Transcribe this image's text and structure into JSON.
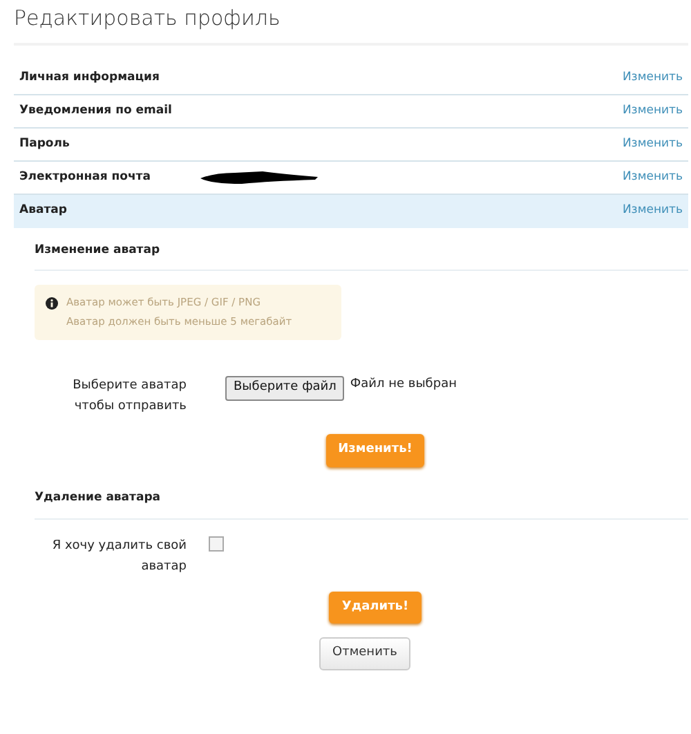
{
  "title": "Редактировать профиль",
  "sections": [
    {
      "label": "Личная информация",
      "action": "Изменить",
      "selected": false,
      "redacted": false
    },
    {
      "label": "Уведомления по email",
      "action": "Изменить",
      "selected": false,
      "redacted": false
    },
    {
      "label": "Пароль",
      "action": "Изменить",
      "selected": false,
      "redacted": false
    },
    {
      "label": "Электронная почта",
      "action": "Изменить",
      "selected": false,
      "redacted": true
    },
    {
      "label": "Аватар",
      "action": "Изменить",
      "selected": true,
      "redacted": false
    }
  ],
  "change_avatar": {
    "heading": "Изменение аватар",
    "notice": [
      "Аватар может быть JPEG / GIF / PNG",
      "Аватар должен быть меньше 5 мегабайт"
    ],
    "file_label": "Выберите аватар чтобы отправить",
    "file_button": "Выберите файл",
    "file_status": "Файл не выбран",
    "submit": "Изменить!"
  },
  "delete_avatar": {
    "heading": "Удаление аватара",
    "checkbox_label": "Я хочу удалить свой аватар",
    "checked": false,
    "submit": "Удалить!"
  },
  "cancel": "Отменить"
}
